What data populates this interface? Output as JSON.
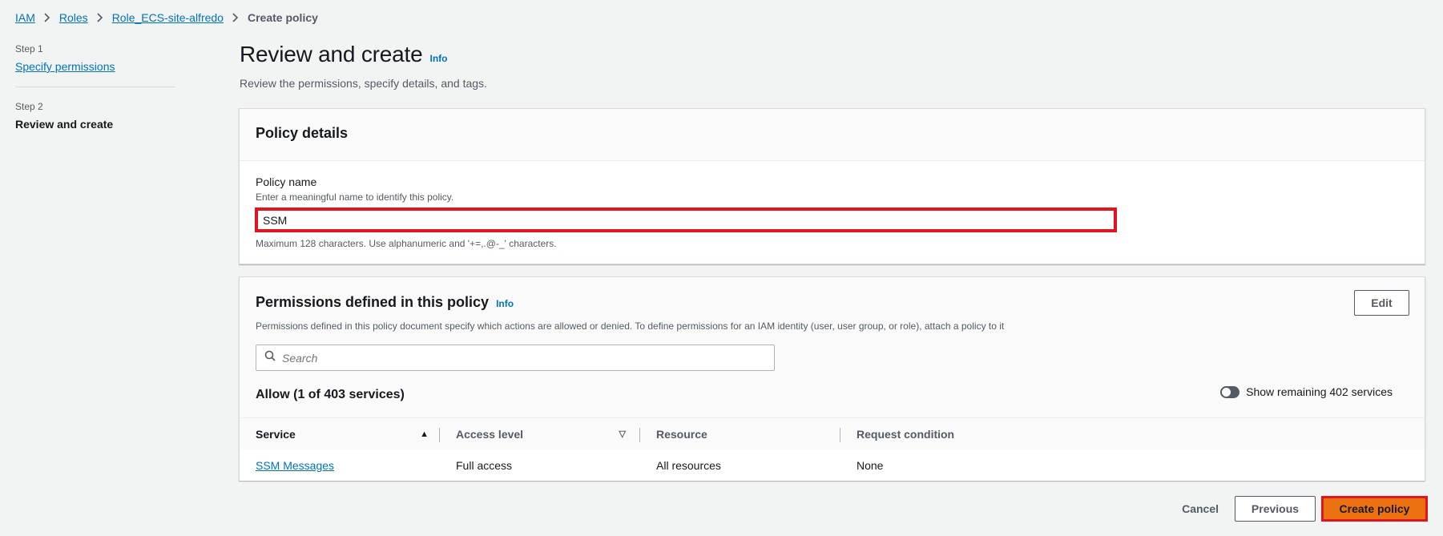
{
  "breadcrumb": {
    "items": [
      "IAM",
      "Roles",
      "Role_ECS-site-alfredo"
    ],
    "current": "Create policy"
  },
  "steps": [
    {
      "number": "Step 1",
      "label": "Specify permissions"
    },
    {
      "number": "Step 2",
      "label": "Review and create"
    }
  ],
  "header": {
    "title": "Review and create",
    "info": "Info",
    "description": "Review the permissions, specify details, and tags."
  },
  "policy_details": {
    "title": "Policy details",
    "name_label": "Policy name",
    "name_description": "Enter a meaningful name to identify this policy.",
    "name_value": "SSM",
    "name_constraint": "Maximum 128 characters. Use alphanumeric and '+=,.@-_' characters."
  },
  "permissions": {
    "title": "Permissions defined in this policy",
    "info": "Info",
    "edit_label": "Edit",
    "description": "Permissions defined in this policy document specify which actions are allowed or denied. To define permissions for an IAM identity (user, user group, or role), attach a policy to it",
    "search_placeholder": "Search",
    "allow_title": "Allow (1 of 403 services)",
    "toggle_label": "Show remaining 402 services",
    "columns": [
      "Service",
      "Access level",
      "Resource",
      "Request condition"
    ],
    "rows": [
      {
        "service": "SSM Messages",
        "access": "Full access",
        "resource": "All resources",
        "condition": "None"
      }
    ]
  },
  "footer": {
    "cancel": "Cancel",
    "previous": "Previous",
    "create": "Create policy"
  },
  "colors": {
    "link": "#0073bb",
    "primary_button": "#ec7211",
    "highlight_border": "#e0151d"
  }
}
